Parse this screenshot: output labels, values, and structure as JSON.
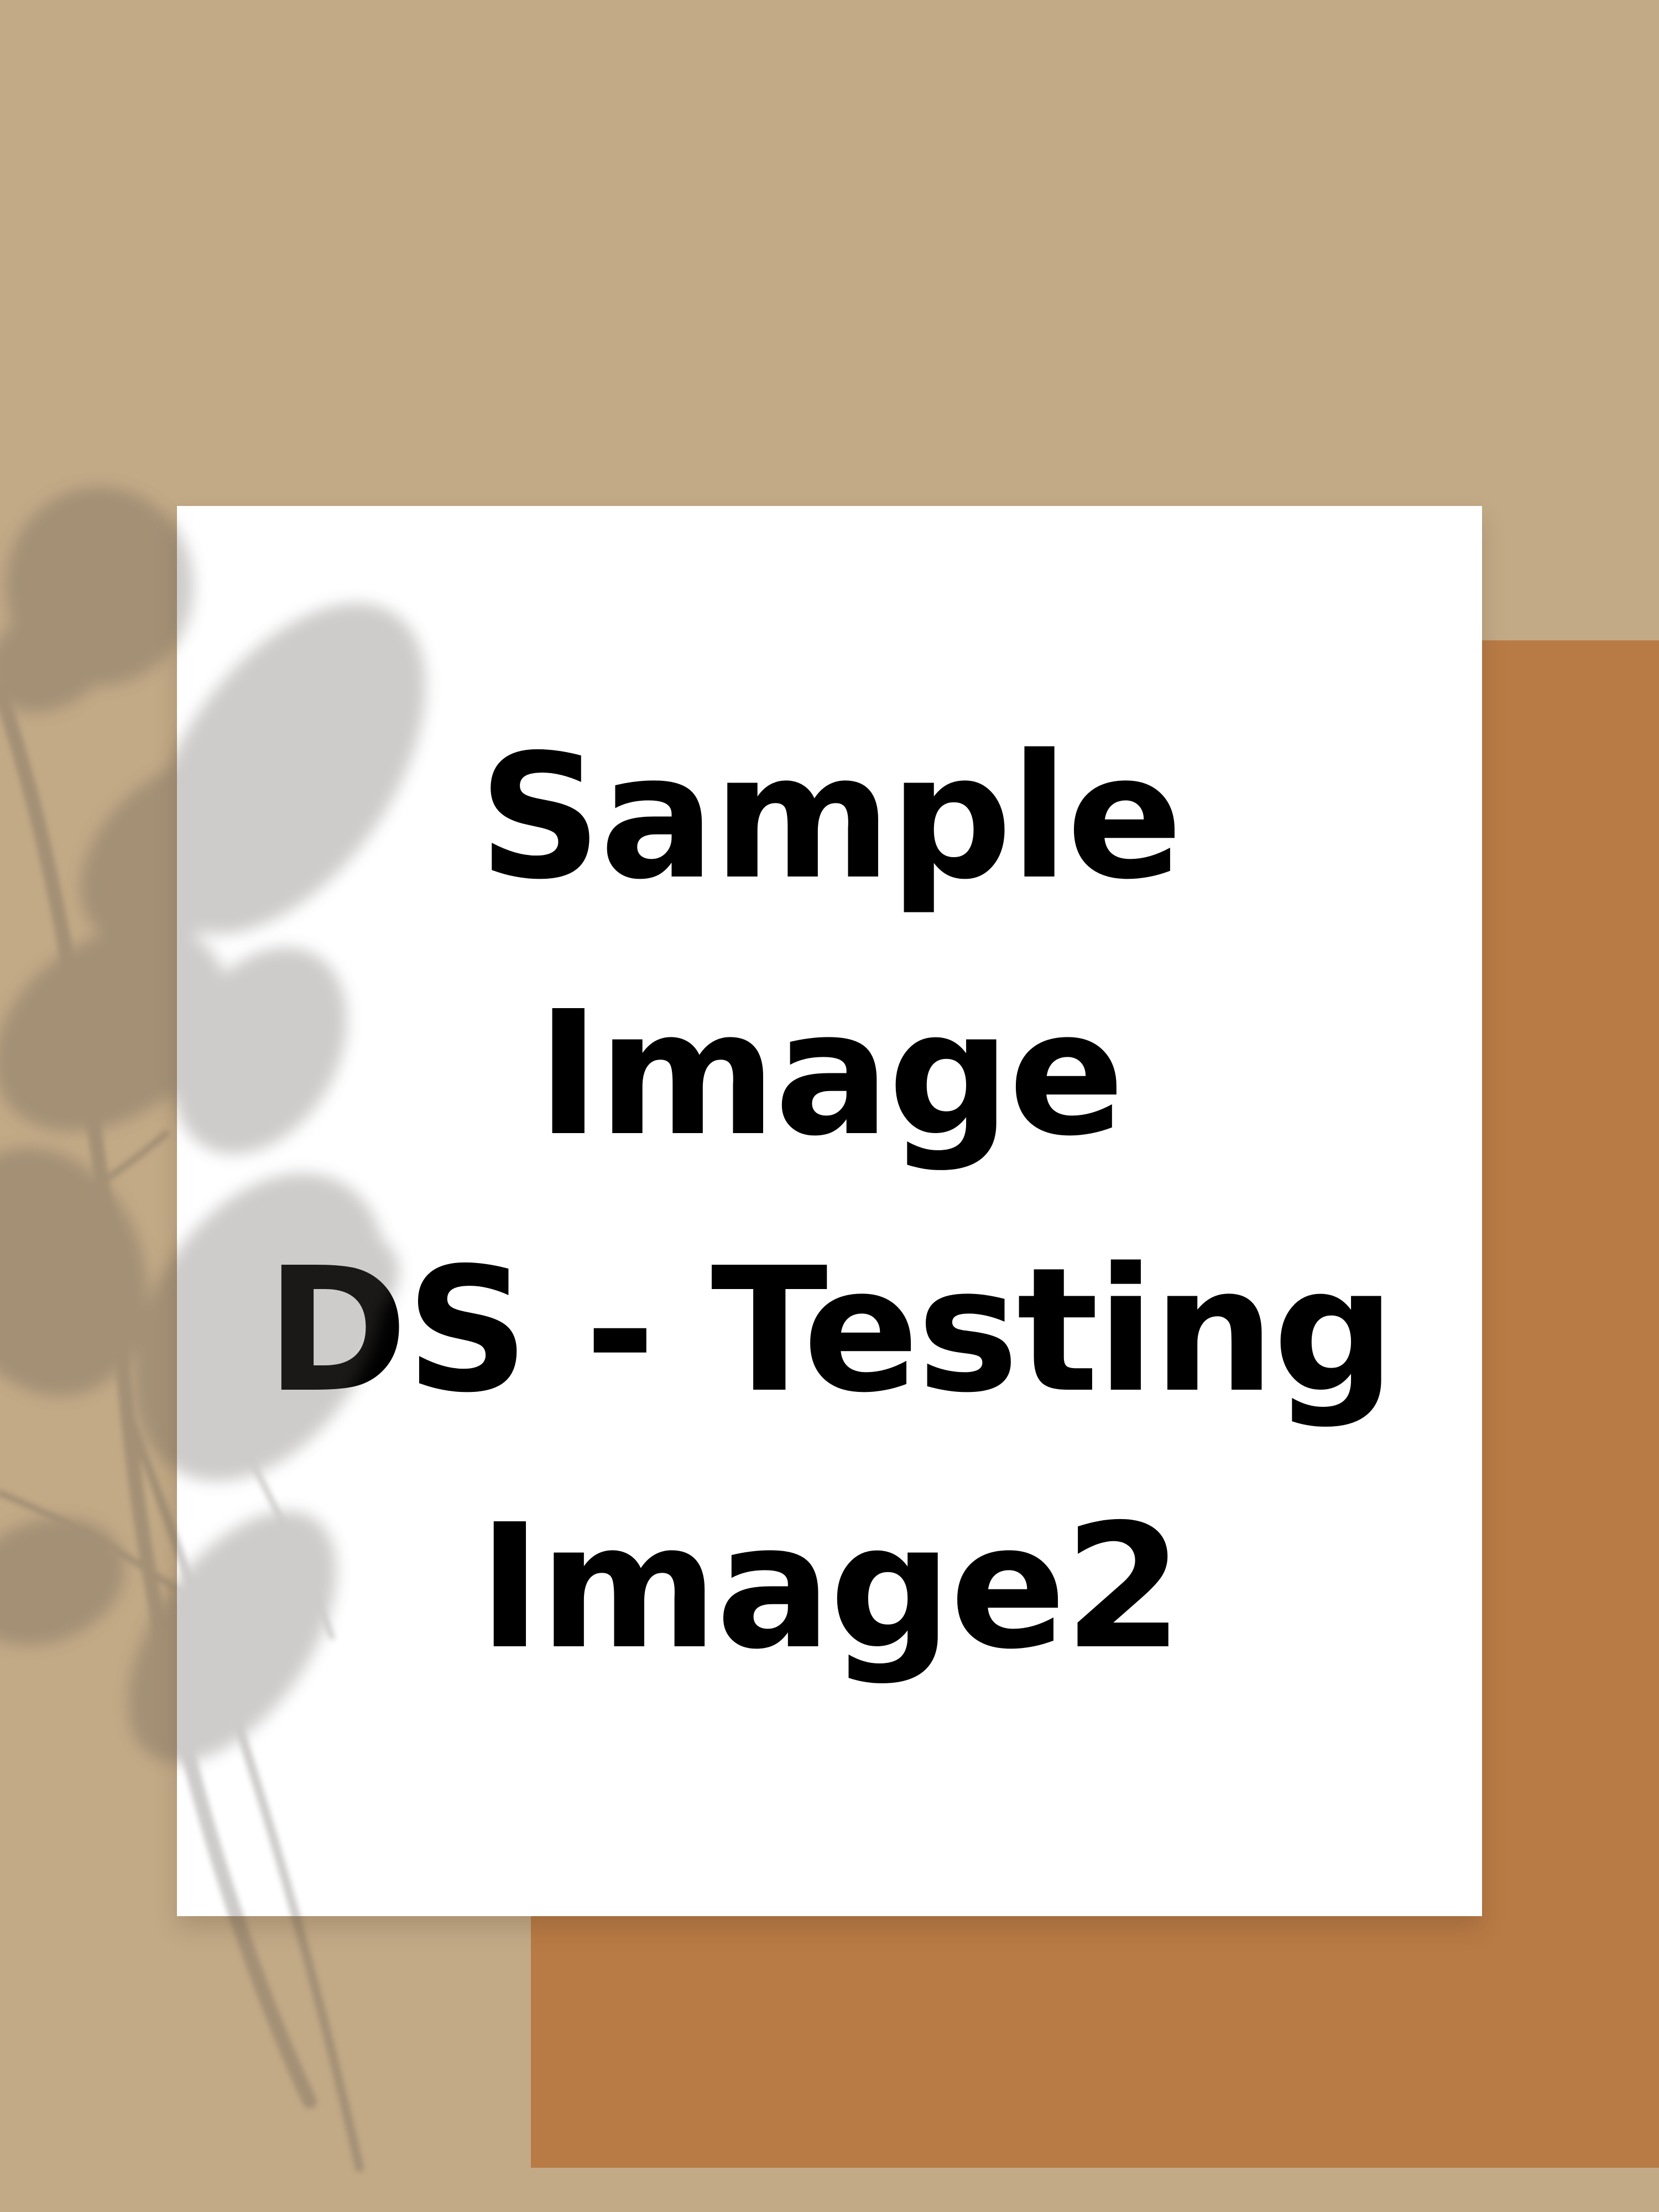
{
  "poster": {
    "lines": [
      "Sample",
      "Image",
      "DS - Testing",
      "Image2"
    ]
  },
  "colors": {
    "background": "#c3aa87",
    "accent_block": "#b97b45",
    "card": "#ffffff",
    "text": "#000000",
    "shadow": "#5a5550"
  },
  "decorations": {
    "plant_shadow": "eucalyptus-branch-shadow"
  }
}
